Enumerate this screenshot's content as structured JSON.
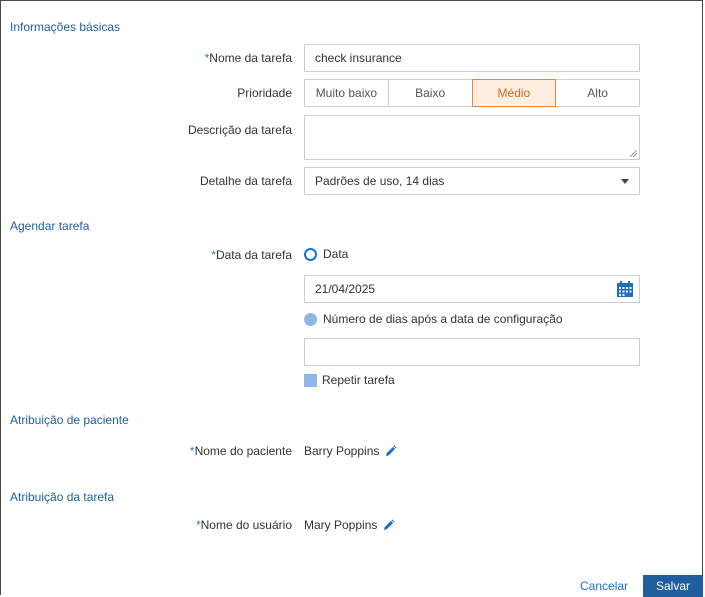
{
  "sections": {
    "basic_info": "Informações básicas",
    "schedule": "Agendar tarefa",
    "patient": "Atribuição de paciente",
    "task_assign": "Atribuição da tarefa"
  },
  "fields": {
    "task_name": {
      "required_mark": "*",
      "label": "Nome da tarefa",
      "value": "check insurance"
    },
    "priority": {
      "label": "Prioridade",
      "options": [
        "Muito baixo",
        "Baixo",
        "Médio",
        "Alto"
      ],
      "selected": "Médio"
    },
    "description": {
      "label": "Descrição da tarefa",
      "value": ""
    },
    "task_detail": {
      "label": "Detalhe da tarefa",
      "value": "Padrões de uso, 14 dias"
    },
    "task_date": {
      "required_mark": "*",
      "label": "Data da tarefa",
      "option_date": "Data",
      "date_value": "21/04/2025",
      "option_days": "Número de dias após a data de configuração",
      "days_value": ""
    },
    "repeat": {
      "label": "Repetir tarefa"
    },
    "patient_name": {
      "required_mark": "*",
      "label": "Nome do paciente",
      "value": "Barry Poppins"
    },
    "user_name": {
      "required_mark": "*",
      "label": "Nome do usuário",
      "value": "Mary Poppins"
    }
  },
  "actions": {
    "cancel": "Cancelar",
    "save": "Salvar"
  },
  "colors": {
    "accent": "#1f5f9e",
    "selected_priority": "#e8833a",
    "radio": "#1a6fd1"
  },
  "icons": {
    "calendar": "calendar-icon",
    "edit": "pencil-icon",
    "dropdown": "chevron-down-icon"
  }
}
